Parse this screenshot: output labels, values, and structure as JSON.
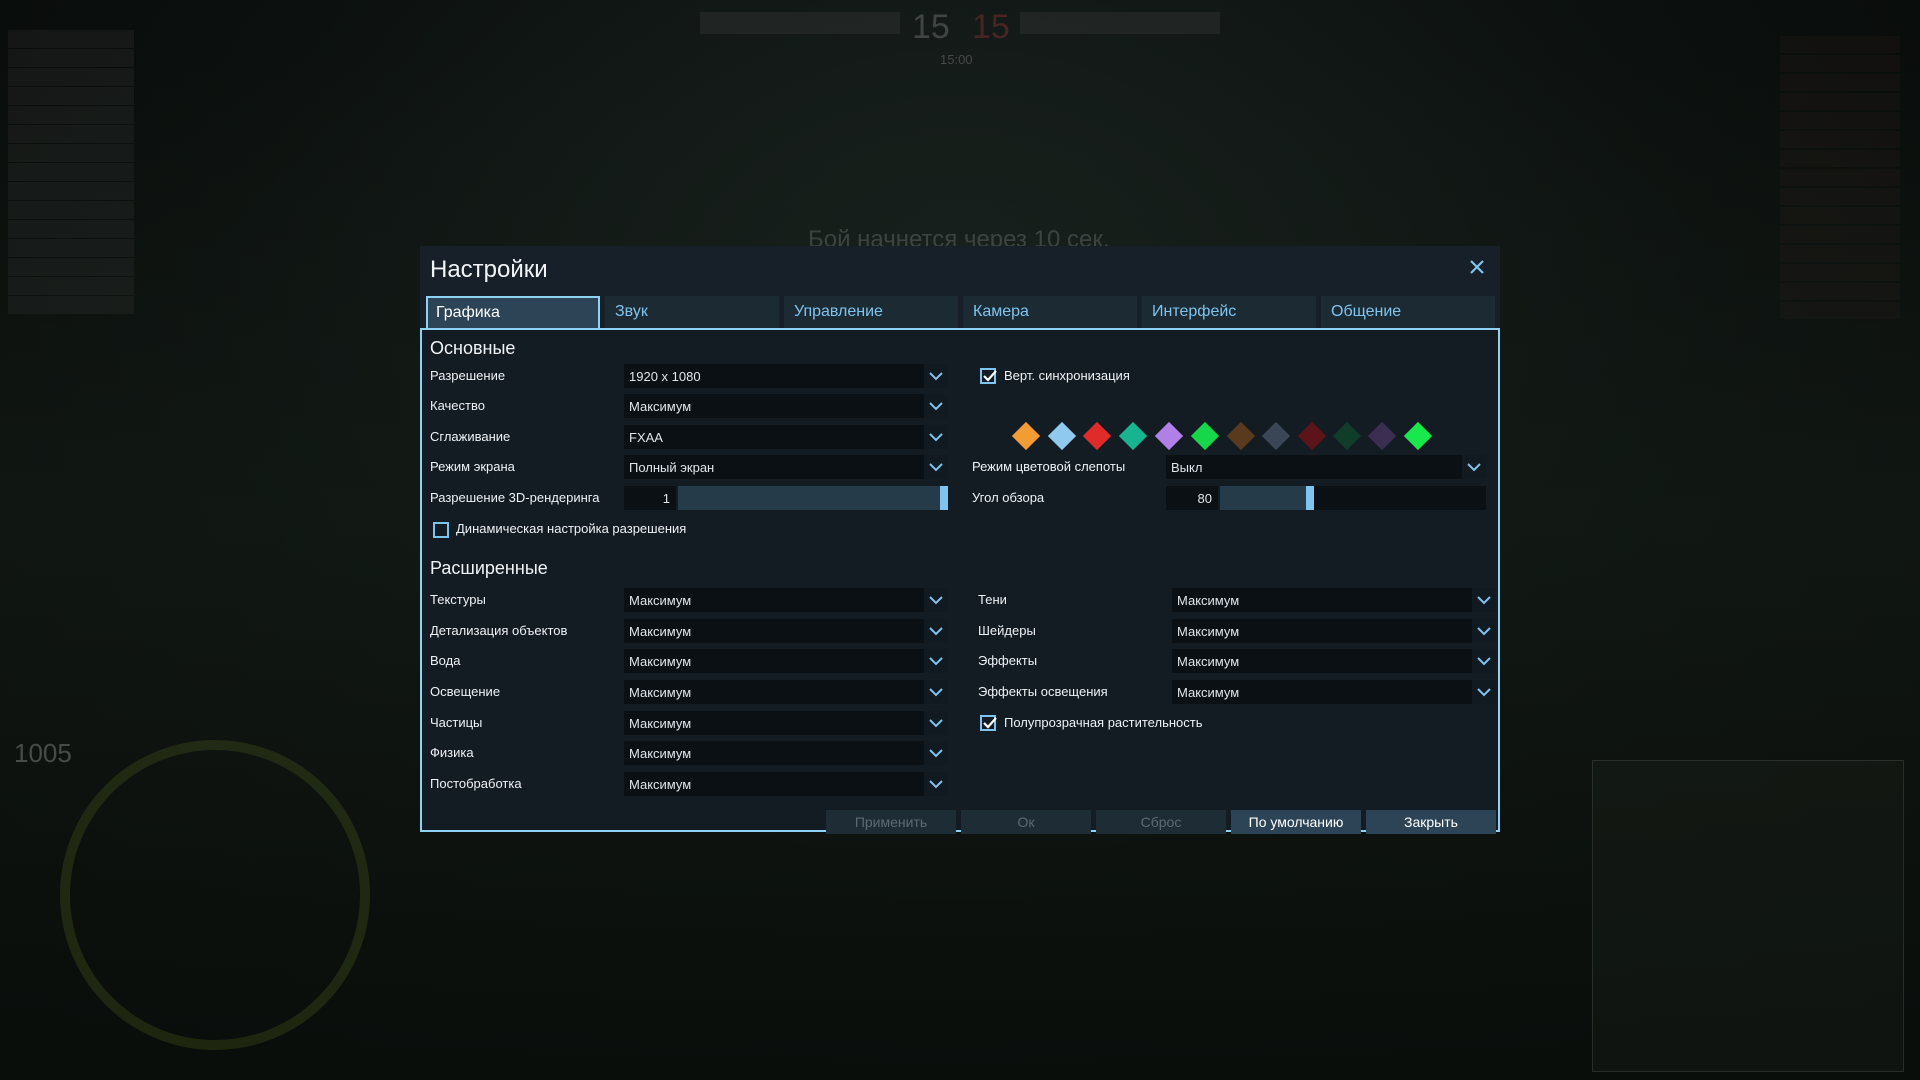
{
  "dialog": {
    "title": "Настройки",
    "tabs": [
      {
        "label": "Графика",
        "active": true
      },
      {
        "label": "Звук",
        "active": false
      },
      {
        "label": "Управление",
        "active": false
      },
      {
        "label": "Камера",
        "active": false
      },
      {
        "label": "Интерфейс",
        "active": false
      },
      {
        "label": "Общение",
        "active": false
      }
    ]
  },
  "basic": {
    "title": "Основные",
    "resolution": {
      "label": "Разрешение",
      "value": "1920 x 1080"
    },
    "quality": {
      "label": "Качество",
      "value": "Максимум"
    },
    "antialiasing": {
      "label": "Сглаживание",
      "value": "FXAA"
    },
    "screen_mode": {
      "label": "Режим экрана",
      "value": "Полный экран"
    },
    "render_res": {
      "label": "Разрешение 3D-рендеринга",
      "value": "1",
      "level": 1.0
    },
    "dynamic_res": {
      "label": "Динамическая настройка разрешения",
      "checked": false
    },
    "vsync": {
      "label": "Верт. синхронизация",
      "checked": true
    },
    "colorblind": {
      "label": "Режим цветовой слепоты",
      "value": "Выкл"
    },
    "fov": {
      "label": "Угол обзора",
      "value": "80",
      "level": 0.34
    },
    "color_swatches": [
      "#f39c33",
      "#8fc9f0",
      "#e02b2b",
      "#18b48f",
      "#b07fe8",
      "#16d64a",
      "#5a3a1c",
      "#3a4656",
      "#5c1418",
      "#0f3d2a",
      "#3c2e52",
      "#18e84c"
    ]
  },
  "advanced": {
    "title": "Расширенные",
    "textures": {
      "label": "Текстуры",
      "value": "Максимум"
    },
    "objects": {
      "label": "Детализация объектов",
      "value": "Максимум"
    },
    "water": {
      "label": "Вода",
      "value": "Максимум"
    },
    "lighting": {
      "label": "Освещение",
      "value": "Максимум"
    },
    "particles": {
      "label": "Частицы",
      "value": "Максимум"
    },
    "physics": {
      "label": "Физика",
      "value": "Максимум"
    },
    "postprocess": {
      "label": "Постобработка",
      "value": "Максимум"
    },
    "shadows": {
      "label": "Тени",
      "value": "Максимум"
    },
    "shaders": {
      "label": "Шейдеры",
      "value": "Максимум"
    },
    "effects": {
      "label": "Эффекты",
      "value": "Максимум"
    },
    "light_effects": {
      "label": "Эффекты освещения",
      "value": "Максимум"
    },
    "translucent": {
      "label": "Полупрозрачная растительность",
      "checked": true
    }
  },
  "buttons": {
    "apply": "Применить",
    "ok": "Ок",
    "reset": "Сброс",
    "defaults": "По умолчанию",
    "close": "Закрыть"
  },
  "hud": {
    "score_left": "15",
    "score_right": "15",
    "timer": "15:00",
    "message": "Бой начнется через 10 сек.",
    "hp": "1005"
  },
  "colors": {
    "accent": "#8fd2f4",
    "panel": "#141c23",
    "tab_active": "#2c4456"
  }
}
